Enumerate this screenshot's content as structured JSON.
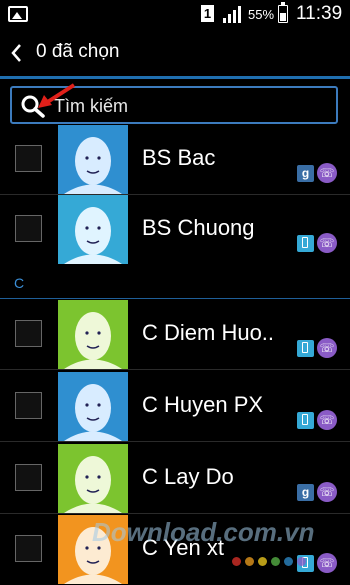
{
  "status_bar": {
    "sim_slot": "1",
    "battery_percent": "55%",
    "battery_level": 0.55,
    "time": "11:39"
  },
  "action_bar": {
    "selected_text": "0 đã chọn"
  },
  "search": {
    "placeholder": "Tìm kiếm"
  },
  "sections": [
    {
      "letter": "C"
    }
  ],
  "contacts": [
    {
      "name": "BS Bac",
      "avatar_color": "#2f8fd0",
      "badges": [
        "google",
        "viber"
      ]
    },
    {
      "name": "BS Chuong",
      "avatar_color": "#35a9d6",
      "badges": [
        "phone",
        "viber"
      ]
    },
    {
      "name": "C Diem Huo..",
      "avatar_color": "#7cc42f",
      "badges": [
        "phone",
        "viber"
      ]
    },
    {
      "name": "C Huyen PX",
      "avatar_color": "#2f8fd0",
      "badges": [
        "phone",
        "viber"
      ]
    },
    {
      "name": "C Lay Do",
      "avatar_color": "#7cc42f",
      "badges": [
        "google",
        "viber"
      ]
    },
    {
      "name": "C Yen xt",
      "avatar_color": "#f2941f",
      "badges": [
        "phone",
        "viber"
      ]
    }
  ],
  "watermark": "Download.com.vn",
  "colors": {
    "accent_blue": "#1f6fb0",
    "section_text": "#3b8fd8",
    "arrow_red": "#e0201a"
  }
}
